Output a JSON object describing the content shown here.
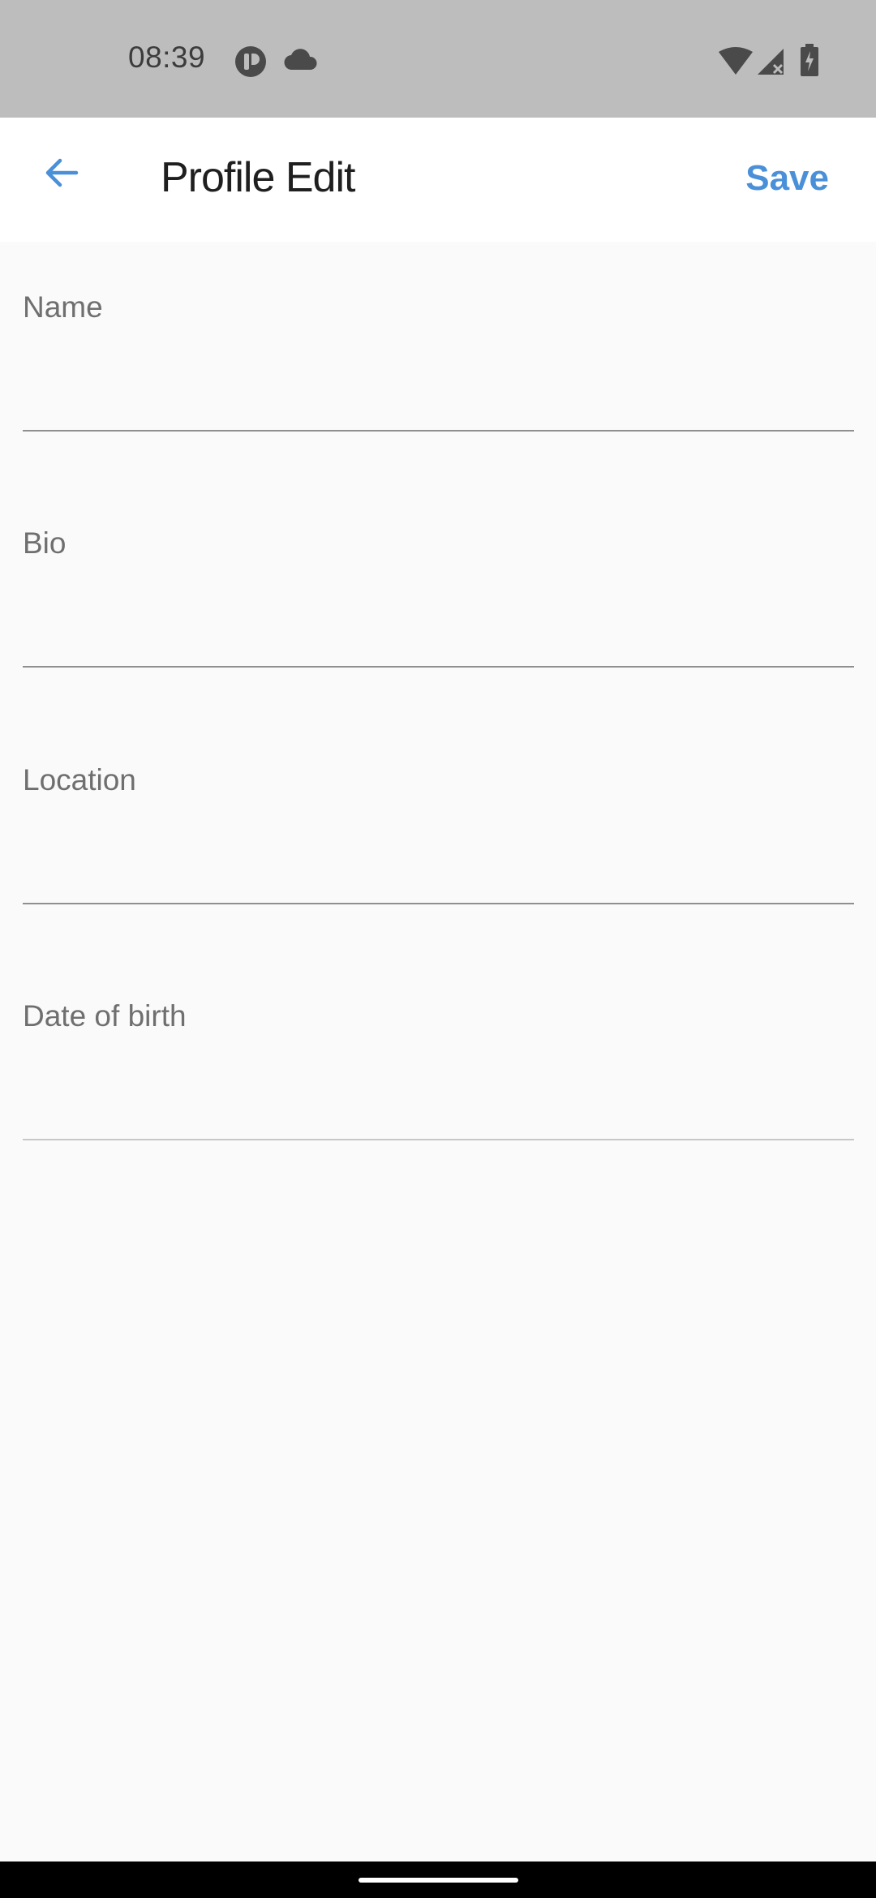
{
  "status_bar": {
    "time": "08:39",
    "icons": [
      "app-indicator-icon",
      "cloud-icon",
      "wifi-icon",
      "signal-icon",
      "battery-icon"
    ]
  },
  "app_bar": {
    "back_icon": "arrow-back-icon",
    "title": "Profile Edit",
    "save_label": "Save",
    "accent_color": "#4a90d9"
  },
  "form": {
    "fields": [
      {
        "label": "Name",
        "value": ""
      },
      {
        "label": "Bio",
        "value": ""
      },
      {
        "label": "Location",
        "value": ""
      },
      {
        "label": "Date of birth",
        "value": ""
      }
    ]
  }
}
